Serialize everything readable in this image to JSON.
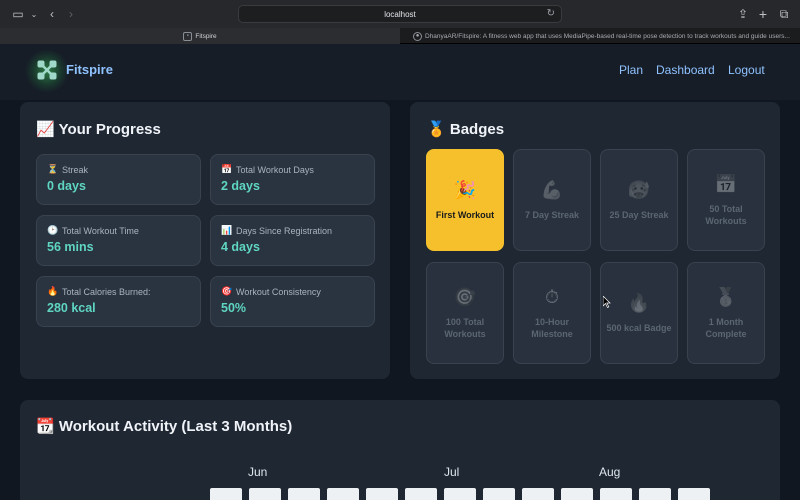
{
  "browser": {
    "url": "localhost",
    "tabs": [
      {
        "title": "Fitspire"
      },
      {
        "title": "DhanyaAR/Fitspire: A fitness web app that uses MediaPipe-based real-time pose detection to track workouts and guide users..."
      }
    ]
  },
  "header": {
    "brand": "Fitspire",
    "nav": [
      {
        "label": "Plan"
      },
      {
        "label": "Dashboard"
      },
      {
        "label": "Logout"
      }
    ]
  },
  "progress": {
    "icon": "📈",
    "title": "Your Progress",
    "stats": [
      {
        "icon": "⏳",
        "label": "Streak",
        "value": "0 days"
      },
      {
        "icon": "📅",
        "label": "Total Workout Days",
        "value": "2 days"
      },
      {
        "icon": "🕑",
        "label": "Total Workout Time",
        "value": "56 mins"
      },
      {
        "icon": "📊",
        "label": "Days Since Registration",
        "value": "4 days"
      },
      {
        "icon": "🔥",
        "label": "Total Calories Burned:",
        "value": "280 kcal"
      },
      {
        "icon": "🎯",
        "label": "Workout Consistency",
        "value": "50%"
      }
    ]
  },
  "badges": {
    "icon": "🏅",
    "title": "Badges",
    "items": [
      {
        "icon": "🎉",
        "label": "First Workout",
        "earned": true
      },
      {
        "icon": "💪",
        "label": "7 Day Streak",
        "earned": false
      },
      {
        "icon": "🥵",
        "label": "25 Day Streak",
        "earned": false
      },
      {
        "icon": "📅",
        "label": "50 Total Workouts",
        "earned": false
      },
      {
        "icon": "🎯",
        "label": "100 Total Workouts",
        "earned": false
      },
      {
        "icon": "⏱",
        "label": "10-Hour Milestone",
        "earned": false
      },
      {
        "icon": "🔥",
        "label": "500 kcal Badge",
        "earned": false
      },
      {
        "icon": "🥇",
        "label": "1 Month Complete",
        "earned": false
      }
    ]
  },
  "activity": {
    "icon": "📆",
    "title": "Workout Activity (Last 3 Months)",
    "months": [
      "Jun",
      "Jul",
      "Aug"
    ]
  },
  "colors": {
    "accent": "#5fd6c2",
    "link": "#8fc2ff",
    "badge_earned": "#f6c02c"
  }
}
